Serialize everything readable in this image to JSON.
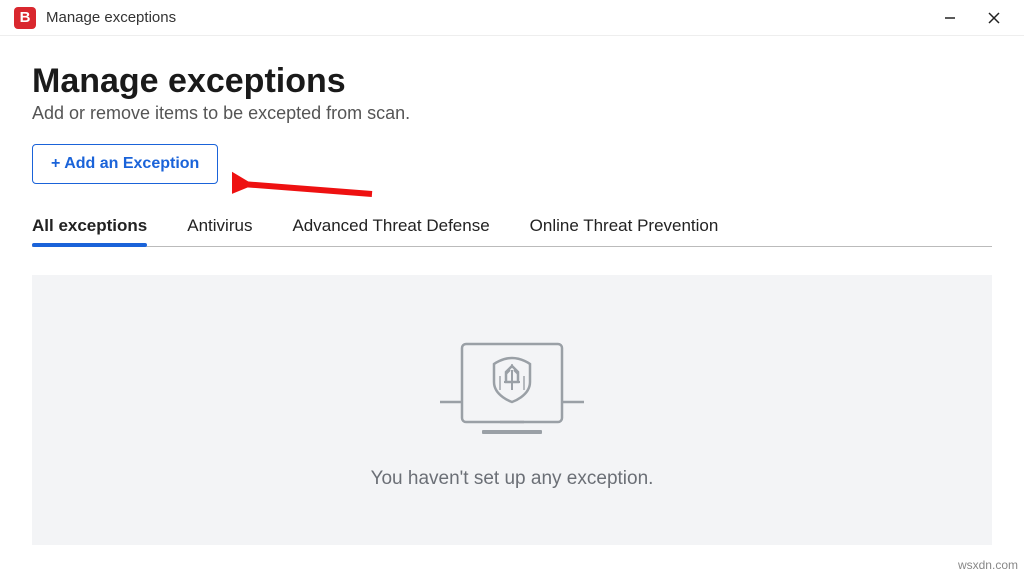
{
  "window": {
    "app_letter": "B",
    "title": "Manage exceptions"
  },
  "header": {
    "title": "Manage exceptions",
    "subtitle": "Add or remove items to be excepted from scan."
  },
  "actions": {
    "add_exception_label": "+ Add an Exception"
  },
  "tabs": {
    "items": [
      {
        "label": "All exceptions",
        "active": true
      },
      {
        "label": "Antivirus",
        "active": false
      },
      {
        "label": "Advanced Threat Defense",
        "active": false
      },
      {
        "label": "Online Threat Prevention",
        "active": false
      }
    ]
  },
  "empty_state": {
    "message": "You haven't set up any exception."
  },
  "watermark": "wsxdn.com"
}
